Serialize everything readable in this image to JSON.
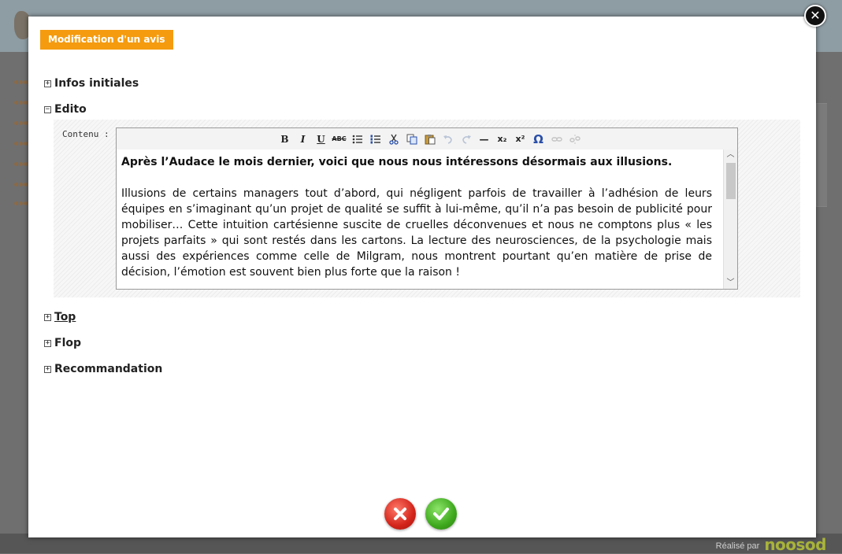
{
  "modal": {
    "title": "Modification d'un avis",
    "close_glyph": "✕"
  },
  "sections": {
    "infos": {
      "toggle": "+",
      "label": "Infos initiales"
    },
    "edito": {
      "toggle": "−",
      "label": "Edito"
    },
    "top": {
      "toggle": "+",
      "label": "Top"
    },
    "flop": {
      "toggle": "+",
      "label": "Flop"
    },
    "recommandation": {
      "toggle": "+",
      "label": "Recommandation"
    }
  },
  "edito": {
    "content_label": "Contenu :",
    "toolbar": {
      "bold": "B",
      "italic": "I",
      "underline": "U",
      "strike": "ABC",
      "hr": "—",
      "subscript": "x₂",
      "superscript": "x²",
      "omega": "Ω"
    },
    "paragraphs": [
      "Après l’Audace le mois dernier, voici que nous nous intéressons désormais aux illusions.",
      "Illusions de certains managers tout d’abord, qui négligent parfois de travailler à l’adhésion de leurs équipes en s’imaginant qu’un projet de qualité se suffit à lui-même, qu’il n’a pas besoin de publicité pour mobiliser… Cette intuition cartésienne suscite de cruelles déconvenues et nous ne comptons plus « les projets parfaits » qui sont restés dans les cartons. La lecture des neurosciences, de la psychologie mais aussi des expériences comme celle de Milgram, nous montrent pourtant qu’en matière de prise de décision, l’émotion est souvent bien plus forte que la raison !"
    ]
  },
  "footer": {
    "credit_prefix": "Réalisé par",
    "brand": "noosod"
  },
  "colors": {
    "title_bg": "#f59b0f",
    "cancel": "#d3241a",
    "confirm": "#3ea81d"
  }
}
